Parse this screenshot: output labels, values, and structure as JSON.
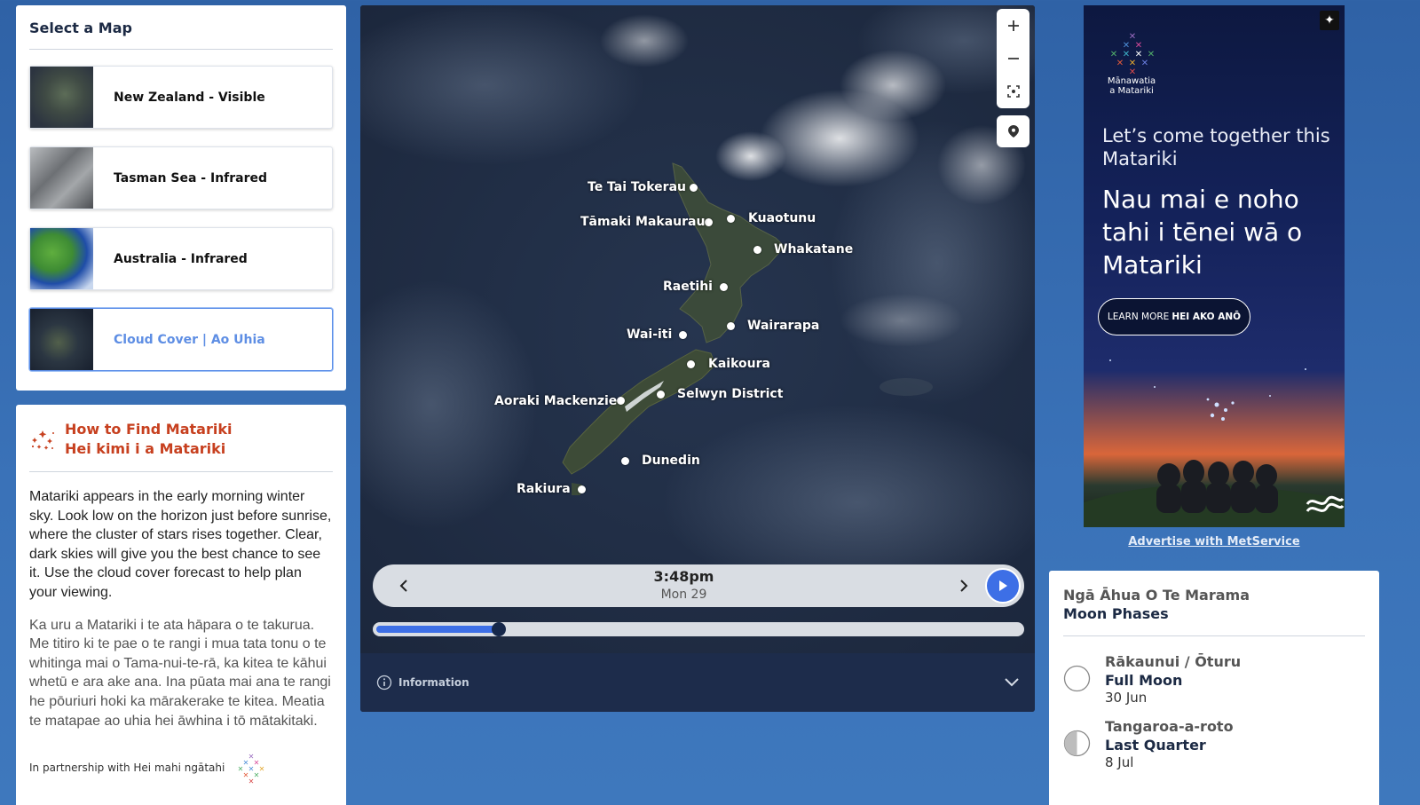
{
  "select_map": {
    "title": "Select a Map",
    "maps": [
      {
        "label": "New Zealand - Visible",
        "active": false
      },
      {
        "label": "Tasman Sea - Infrared",
        "active": false
      },
      {
        "label": "Australia - Infrared",
        "active": false
      },
      {
        "label": "Cloud Cover | Ao Uhia",
        "active": true
      }
    ]
  },
  "find_matariki": {
    "title_en": "How to Find Matariki",
    "title_mi": "Hei kimi i a Matariki",
    "body_en": "Matariki appears in the early morning winter sky. Look low on the horizon just before sunrise, where the cluster of stars rises together. Clear, dark skies will give you the best chance to see it. Use the cloud cover forecast to help plan your viewing.",
    "body_mi": "Ka uru a Matariki i te ata hāpara o te takurua. Me titiro ki te pae o te rangi i mua tata tonu o te whitinga mai o Tama-nui-te-rā, ka kitea te kāhui whetū e ara ake ana. Ina pūata mai ana te rangi he pōuriuri hoki ka mārakerake te kitea. Meatia te matapae ao uhia hei āwhina i tō mātakitaki.",
    "partner": "In partnership with Hei mahi ngātahi"
  },
  "map": {
    "locations": [
      {
        "name": "Te Tai Tokerau"
      },
      {
        "name": "Tāmaki Makaurau"
      },
      {
        "name": "Kuaotunu"
      },
      {
        "name": "Whakatane"
      },
      {
        "name": "Raetihi"
      },
      {
        "name": "Wairarapa"
      },
      {
        "name": "Wai-iti"
      },
      {
        "name": "Kaikoura"
      },
      {
        "name": "Selwyn District"
      },
      {
        "name": "Aoraki Mackenzie"
      },
      {
        "name": "Dunedin"
      },
      {
        "name": "Rakiura"
      }
    ],
    "controls": {
      "zoom_in_icon": "plus-icon",
      "zoom_out_icon": "minus-icon",
      "fullscreen_icon": "focus-icon",
      "locate_icon": "pin-icon"
    },
    "time": "3:48pm",
    "date": "Mon 29",
    "progress": 0.19,
    "info_label": "Information"
  },
  "ad": {
    "logo_text_1": "Mānawatia",
    "logo_text_2": "a Matariki",
    "headline_en": "Let’s come together this Matariki",
    "headline_mi": "Nau mai e noho tahi i tēnei wā o Matariki",
    "cta_prefix": "LEARN MORE",
    "cta_bold": "HEI AKO ANŌ"
  },
  "advertise_link": "Advertise with MetService",
  "moon_phases": {
    "title_mi": "Ngā Āhua O Te Marama",
    "title_en": "Moon Phases",
    "items": [
      {
        "name_mi": "Rākaunui / Ōturu",
        "name_en": "Full Moon",
        "date": "30 Jun",
        "icon": "full-moon-icon"
      },
      {
        "name_mi": "Tangaroa-a-roto",
        "name_en": "Last Quarter",
        "date": "8 Jul",
        "icon": "last-quarter-icon"
      }
    ]
  },
  "colors": {
    "accent": "#3d6fe6",
    "matariki_red": "#c7401f",
    "background": "#3568ad"
  }
}
